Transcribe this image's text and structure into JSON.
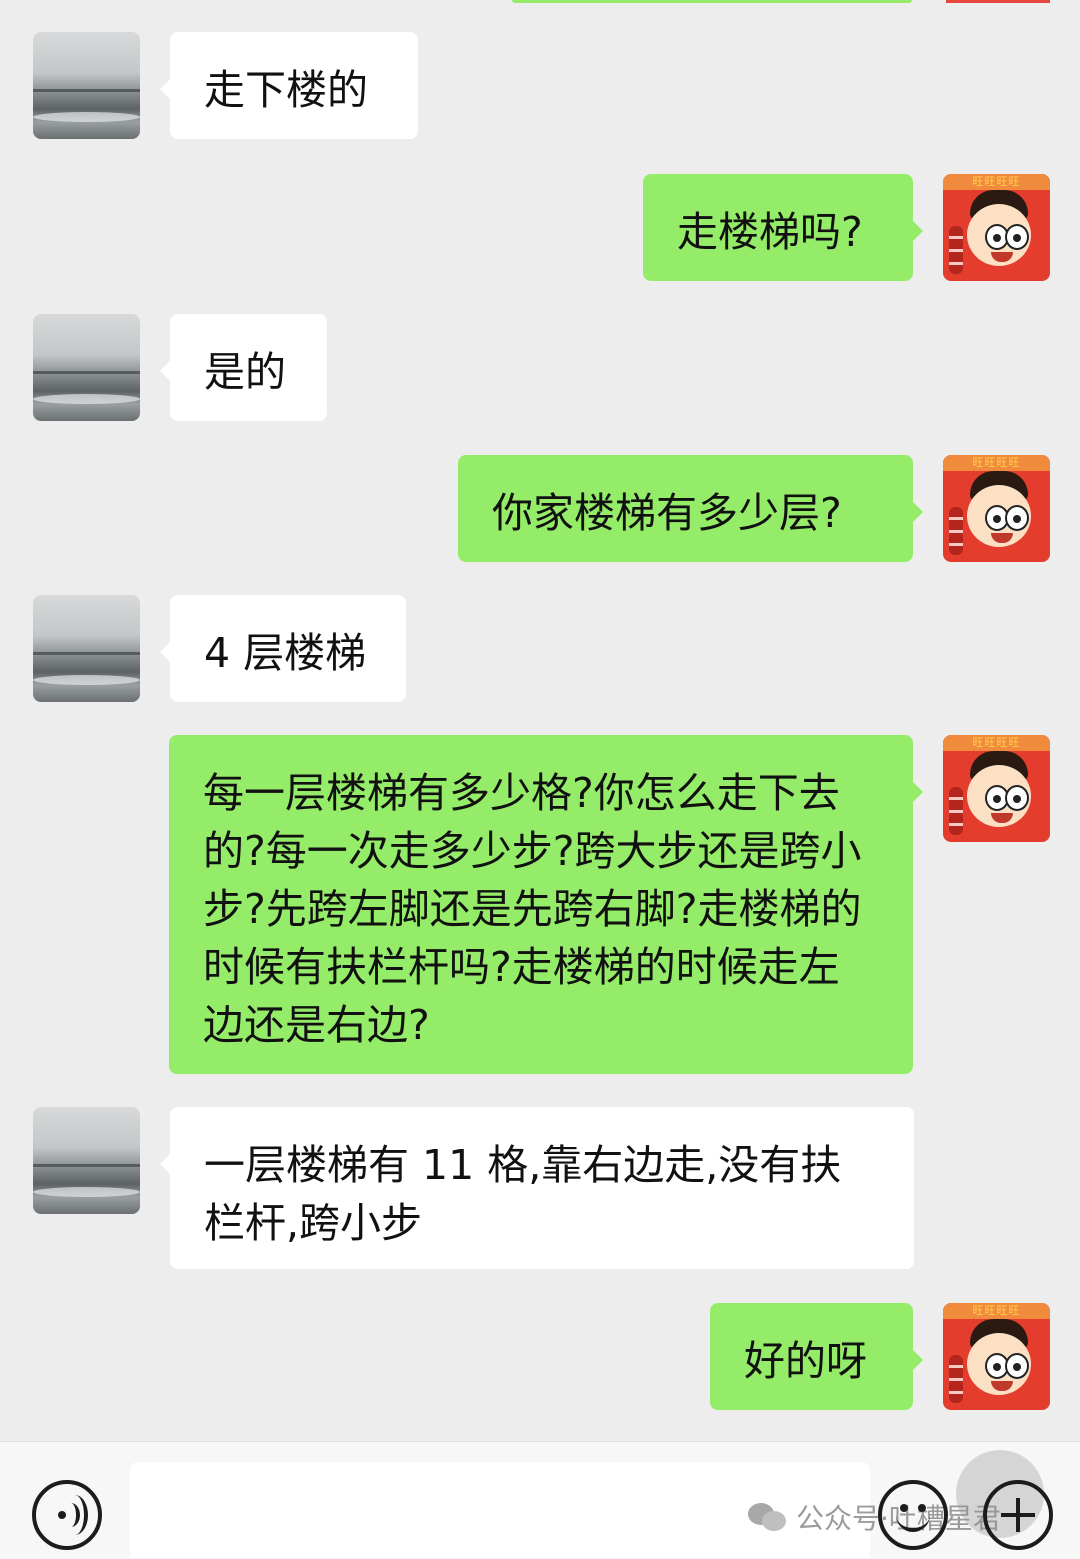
{
  "header": {
    "partial_top": ""
  },
  "messages": [
    {
      "side": "left",
      "text": "走下楼的",
      "avatar": "sea-landscape-avatar"
    },
    {
      "side": "right",
      "text": "走楼梯吗?",
      "avatar": "mascot-avatar"
    },
    {
      "side": "left",
      "text": "是的",
      "avatar": "sea-landscape-avatar"
    },
    {
      "side": "right",
      "text": "你家楼梯有多少层?",
      "avatar": "mascot-avatar"
    },
    {
      "side": "left",
      "text": "4 层楼梯",
      "avatar": "sea-landscape-avatar"
    },
    {
      "side": "right",
      "text": "每一层楼梯有多少格?你怎么走下去的?每一次走多少步?跨大步还是跨小步?先跨左脚还是先跨右脚?走楼梯的时候有扶栏杆吗?走楼梯的时候走左边还是右边?",
      "avatar": "mascot-avatar"
    },
    {
      "side": "left",
      "text": "一层楼梯有 11 格,靠右边走,没有扶栏杆,跨小步",
      "avatar": "sea-landscape-avatar"
    },
    {
      "side": "right",
      "text": "好的呀",
      "avatar": "mascot-avatar"
    }
  ],
  "mascot_band_text": "旺旺旺旺",
  "input_bar": {
    "voice_icon": "voice-icon",
    "emoji_icon": "emoji-icon",
    "plus_icon": "plus-icon",
    "input_value": ""
  },
  "watermark": {
    "text": "公众号·吐槽星君"
  },
  "colors": {
    "background": "#ededed",
    "left_bubble": "#ffffff",
    "right_bubble": "#95ec69",
    "text": "#111111"
  }
}
